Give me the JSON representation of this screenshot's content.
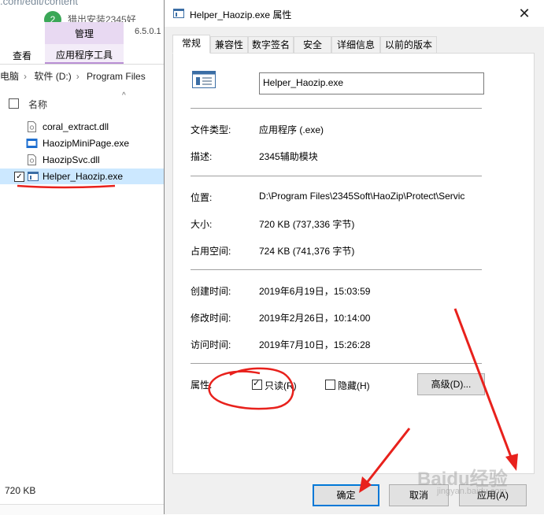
{
  "browser": {
    "url_fragment": ".com/edit/content",
    "badge": "2",
    "tab_partial": "猎出安装2345好"
  },
  "explorer": {
    "ribbon": {
      "manage_label": "管理",
      "view_label": "查看",
      "app_tools_label": "应用程序工具",
      "version": "6.5.0.1"
    },
    "breadcrumb": [
      "电脑",
      "软件 (D:)",
      "Program Files"
    ],
    "column_name": "名称",
    "files": [
      {
        "name": "coral_extract.dll",
        "icon": "dll-file-icon",
        "selected": false
      },
      {
        "name": "HaozipMiniPage.exe",
        "icon": "haozip-exe-icon",
        "selected": false
      },
      {
        "name": "HaozipSvc.dll",
        "icon": "dll-file-icon",
        "selected": false
      },
      {
        "name": "Helper_Haozip.exe",
        "icon": "exe-file-icon",
        "selected": true
      }
    ],
    "status_size": "720 KB"
  },
  "dialog": {
    "title": "Helper_Haozip.exe 属性",
    "close_glyph": "✕",
    "tabs": [
      "常规",
      "兼容性",
      "数字签名",
      "安全",
      "详细信息",
      "以前的版本"
    ],
    "active_tab": 0,
    "file_name": "Helper_Haozip.exe",
    "fields": {
      "file_type_label": "文件类型:",
      "file_type_value": "应用程序 (.exe)",
      "description_label": "描述:",
      "description_value": "2345辅助模块",
      "location_label": "位置:",
      "location_value": "D:\\Program Files\\2345Soft\\HaoZip\\Protect\\Servic",
      "size_label": "大小:",
      "size_value": "720 KB (737,336 字节)",
      "disk_size_label": "占用空间:",
      "disk_size_value": "724 KB (741,376 字节)",
      "created_label": "创建时间:",
      "created_value": "2019年6月19日，15:03:59",
      "modified_label": "修改时间:",
      "modified_value": "2019年2月26日，10:14:00",
      "accessed_label": "访问时间:",
      "accessed_value": "2019年7月10日，15:26:28"
    },
    "attributes": {
      "label": "属性:",
      "readonly_label": "只读(R)",
      "readonly_checked": true,
      "hidden_label": "隐藏(H)",
      "hidden_checked": false,
      "advanced_label": "高级(D)..."
    },
    "buttons": {
      "ok": "确定",
      "cancel": "取消",
      "apply": "应用(A)"
    }
  },
  "watermark": {
    "text": "Baidu经验",
    "sub": "jingyan.baidu.com"
  },
  "colors": {
    "annotation_red": "#e8211c",
    "selection_blue": "#cce8ff",
    "focus_blue": "#0078d7",
    "ribbon_purple": "#e8d9f2"
  }
}
